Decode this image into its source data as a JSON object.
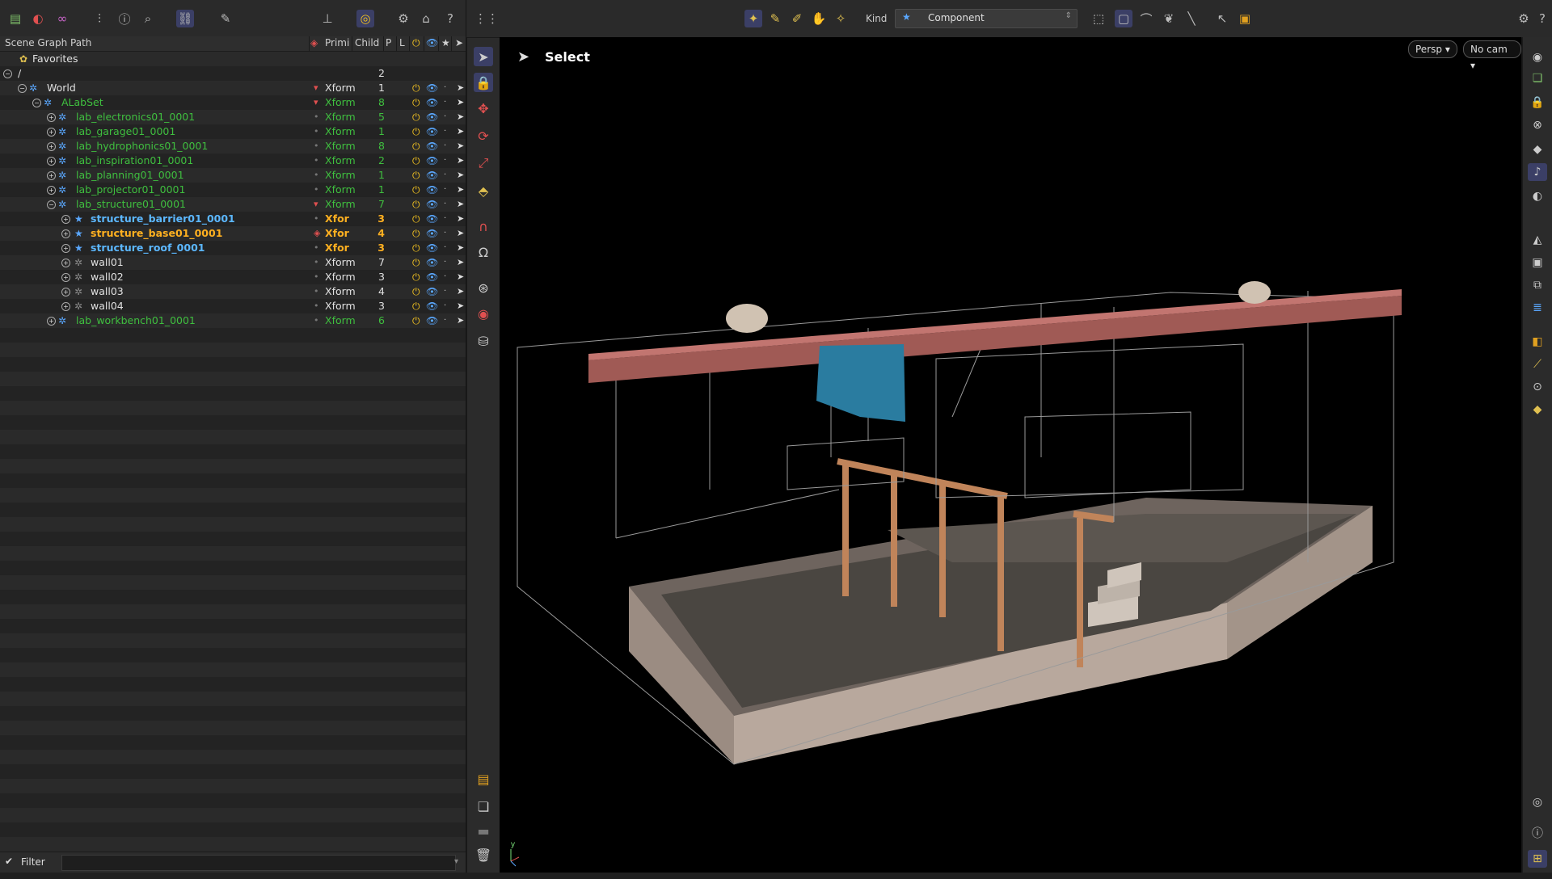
{
  "scene_graph": {
    "columns": {
      "path": "Scene Graph Path",
      "prim": "Primi",
      "child": "Child",
      "p": "P",
      "l": "L"
    },
    "favorites_label": "Favorites",
    "rows": [
      {
        "name": "/",
        "prim": "",
        "child": "2"
      },
      {
        "name": "World",
        "prim": "Xform",
        "child": "1"
      },
      {
        "name": "ALabSet",
        "prim": "Xform",
        "child": "8"
      },
      {
        "name": "lab_electronics01_0001",
        "prim": "Xform",
        "child": "5"
      },
      {
        "name": "lab_garage01_0001",
        "prim": "Xform",
        "child": "1"
      },
      {
        "name": "lab_hydrophonics01_0001",
        "prim": "Xform",
        "child": "8"
      },
      {
        "name": "lab_inspiration01_0001",
        "prim": "Xform",
        "child": "2"
      },
      {
        "name": "lab_planning01_0001",
        "prim": "Xform",
        "child": "1"
      },
      {
        "name": "lab_projector01_0001",
        "prim": "Xform",
        "child": "1"
      },
      {
        "name": "lab_structure01_0001",
        "prim": "Xform",
        "child": "7"
      },
      {
        "name": "structure_barrier01_0001",
        "prim": "Xfor",
        "child": "3"
      },
      {
        "name": "structure_base01_0001",
        "prim": "Xfor",
        "child": "4"
      },
      {
        "name": "structure_roof_0001",
        "prim": "Xfor",
        "child": "3"
      },
      {
        "name": "wall01",
        "prim": "Xform",
        "child": "7"
      },
      {
        "name": "wall02",
        "prim": "Xform",
        "child": "3"
      },
      {
        "name": "wall03",
        "prim": "Xform",
        "child": "4"
      },
      {
        "name": "wall04",
        "prim": "Xform",
        "child": "3"
      },
      {
        "name": "lab_workbench01_0001",
        "prim": "Xform",
        "child": "6"
      }
    ],
    "filter_label": "Filter"
  },
  "top_toolbar": {
    "kind_label": "Kind",
    "kind_value": "Component"
  },
  "viewport": {
    "mode_label": "Select",
    "camera_view": "Persp",
    "camera": "No cam",
    "axis_label": "y"
  },
  "colors": {
    "accent": "#3b3f66",
    "active_prim_green": "#3fbf3f",
    "selected_blue": "#5cb8ff",
    "selected_orange": "#ffb020"
  }
}
